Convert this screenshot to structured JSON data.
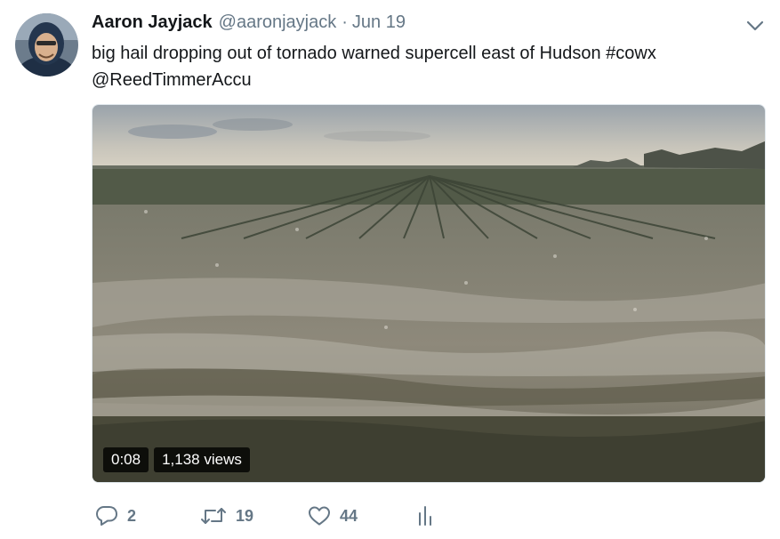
{
  "tweet": {
    "author": {
      "name": "Aaron Jayjack",
      "handle": "@aaronjayjack",
      "separator": "·",
      "date": "Jun 19"
    },
    "text": {
      "line1_plain": "big hail dropping out of tornado warned supercell east of Hudson ",
      "hashtag": "#cowx",
      "mention": "@ReedTimmerAccu"
    },
    "media": {
      "duration": "0:08",
      "views": "1,138 views"
    },
    "actions": {
      "reply_count": "2",
      "retweet_count": "19",
      "like_count": "44"
    }
  },
  "icons": {
    "avatar": "avatar-photo",
    "menu": "chevron-down-icon",
    "reply": "reply-icon",
    "retweet": "retweet-icon",
    "like": "heart-icon",
    "analytics": "analytics-icon"
  },
  "colors": {
    "primary_text": "#14171a",
    "secondary_text": "#657786",
    "border": "#e1e8ed"
  }
}
